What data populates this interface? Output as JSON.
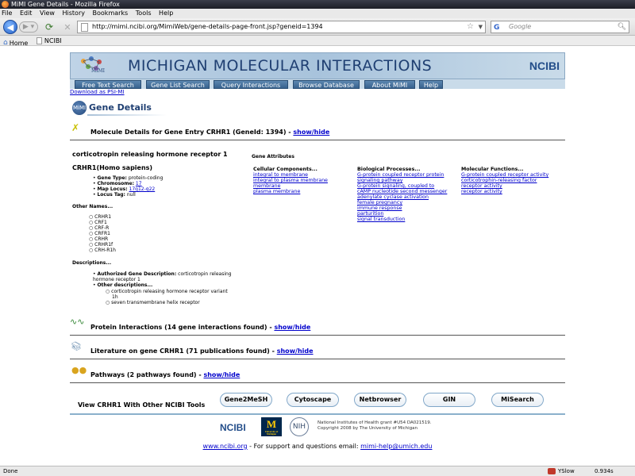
{
  "window": {
    "title": "MiMI Gene Details - Mozilla Firefox"
  },
  "menu": [
    "File",
    "Edit",
    "View",
    "History",
    "Bookmarks",
    "Tools",
    "Help"
  ],
  "navigation": {
    "url": "http://mimi.ncibi.org/MimiWeb/gene-details-page-front.jsp?geneid=1394",
    "search_placeholder": "Google",
    "search_engine_icon": "G"
  },
  "bookmarks": [
    "Home",
    "NCIBI"
  ],
  "banner": {
    "title": "MICHIGAN MOLECULAR INTERACTIONS",
    "brand": "NCIBI",
    "logo_label": "MIMI"
  },
  "tabs": [
    "Free Text Search",
    "Gene List Search",
    "Query Interactions",
    "Browse Database",
    "About MiMI",
    "Help"
  ],
  "download_link": "Download as PSI-MI",
  "page_heading": "Gene Details",
  "gene_logo": "MiMI",
  "molecule": {
    "heading": "Molecule Details for Gene Entry CRHR1 (GeneId: 1394) - ",
    "toggle": "show/hide",
    "full_name": "corticotropin releasing hormone receptor 1",
    "species": "CRHR1(Homo sapiens)",
    "gene_type_label": "Gene Type:",
    "gene_type": "protein-coding",
    "chromosome_label": "Chromosome:",
    "chromosome": "17",
    "map_locus_label": "Map Locus:",
    "map_locus": "17q12-q22",
    "locus_tag_label": "Locus Tag:",
    "locus_tag": "null",
    "other_names_heading": "Other Names...",
    "other_names": [
      "CRHR1",
      "CRF1",
      "CRF-R",
      "CRFR1",
      "CRHR",
      "CRHR1f",
      "CRH-R1h"
    ],
    "descriptions_heading": "Descriptions...",
    "authorized_label": "Authorized Gene Description:",
    "authorized_desc_1": "corticotropin releasing",
    "authorized_desc_2": "hormone receptor 1",
    "other_desc_label": "Other descriptions...",
    "other_desc_1a": "corticotropin releasing hormone receptor variant",
    "other_desc_1b": "1h",
    "other_desc_2": "seven transmembrane helix receptor"
  },
  "gene_attributes": {
    "heading": "Gene Attributes",
    "cellular_heading": "Cellular Components...",
    "cellular": [
      "integral to membrane",
      "integral to plasma membrane",
      "membrane",
      "plasma membrane"
    ],
    "biological_heading": "Biological Processes...",
    "biological": [
      "G-protein coupled receptor protein",
      "signaling pathway",
      "G-protein signaling, coupled to",
      "cAMP nucleotide second messenger",
      "adenylate cyclase activation",
      "female pregnancy",
      "immune response",
      "parturition",
      "signal transduction"
    ],
    "molecular_heading": "Molecular Functions...",
    "molecular": [
      "G-protein coupled receptor activity",
      "corticotrophin-releasing factor",
      "receptor activity",
      "receptor activity"
    ]
  },
  "sections": {
    "interactions": {
      "text": "Protein Interactions (14 gene interactions found) - ",
      "toggle": "show/hide"
    },
    "literature": {
      "text": "Literature on gene CRHR1 (71 publications found) - ",
      "toggle": "show/hide"
    },
    "pathways": {
      "text": "Pathways (2 pathways found) - ",
      "toggle": "show/hide"
    }
  },
  "tools": {
    "label": "View CRHR1 With Other NCIBI Tools",
    "buttons": [
      "Gene2MeSH",
      "Cytoscape",
      "Netbrowser",
      "GIN",
      "MiSearch"
    ]
  },
  "footer": {
    "ncibi_logo": "NCIBI",
    "umich_logo": "M",
    "umich_caption": "University of Michigan",
    "nih_logo": "NIH",
    "grant_line_1": "National Institutes of Health grant #U54 DA021519.",
    "grant_line_2": "Copyright 2008 by The University of Michigan",
    "site_link": "www.ncibi.org",
    "support_text": " - For support and questions email: ",
    "email": "mimi-help@umich.edu"
  },
  "status": {
    "left": "Done",
    "yslow": "YSlow",
    "time": "0.934s"
  }
}
